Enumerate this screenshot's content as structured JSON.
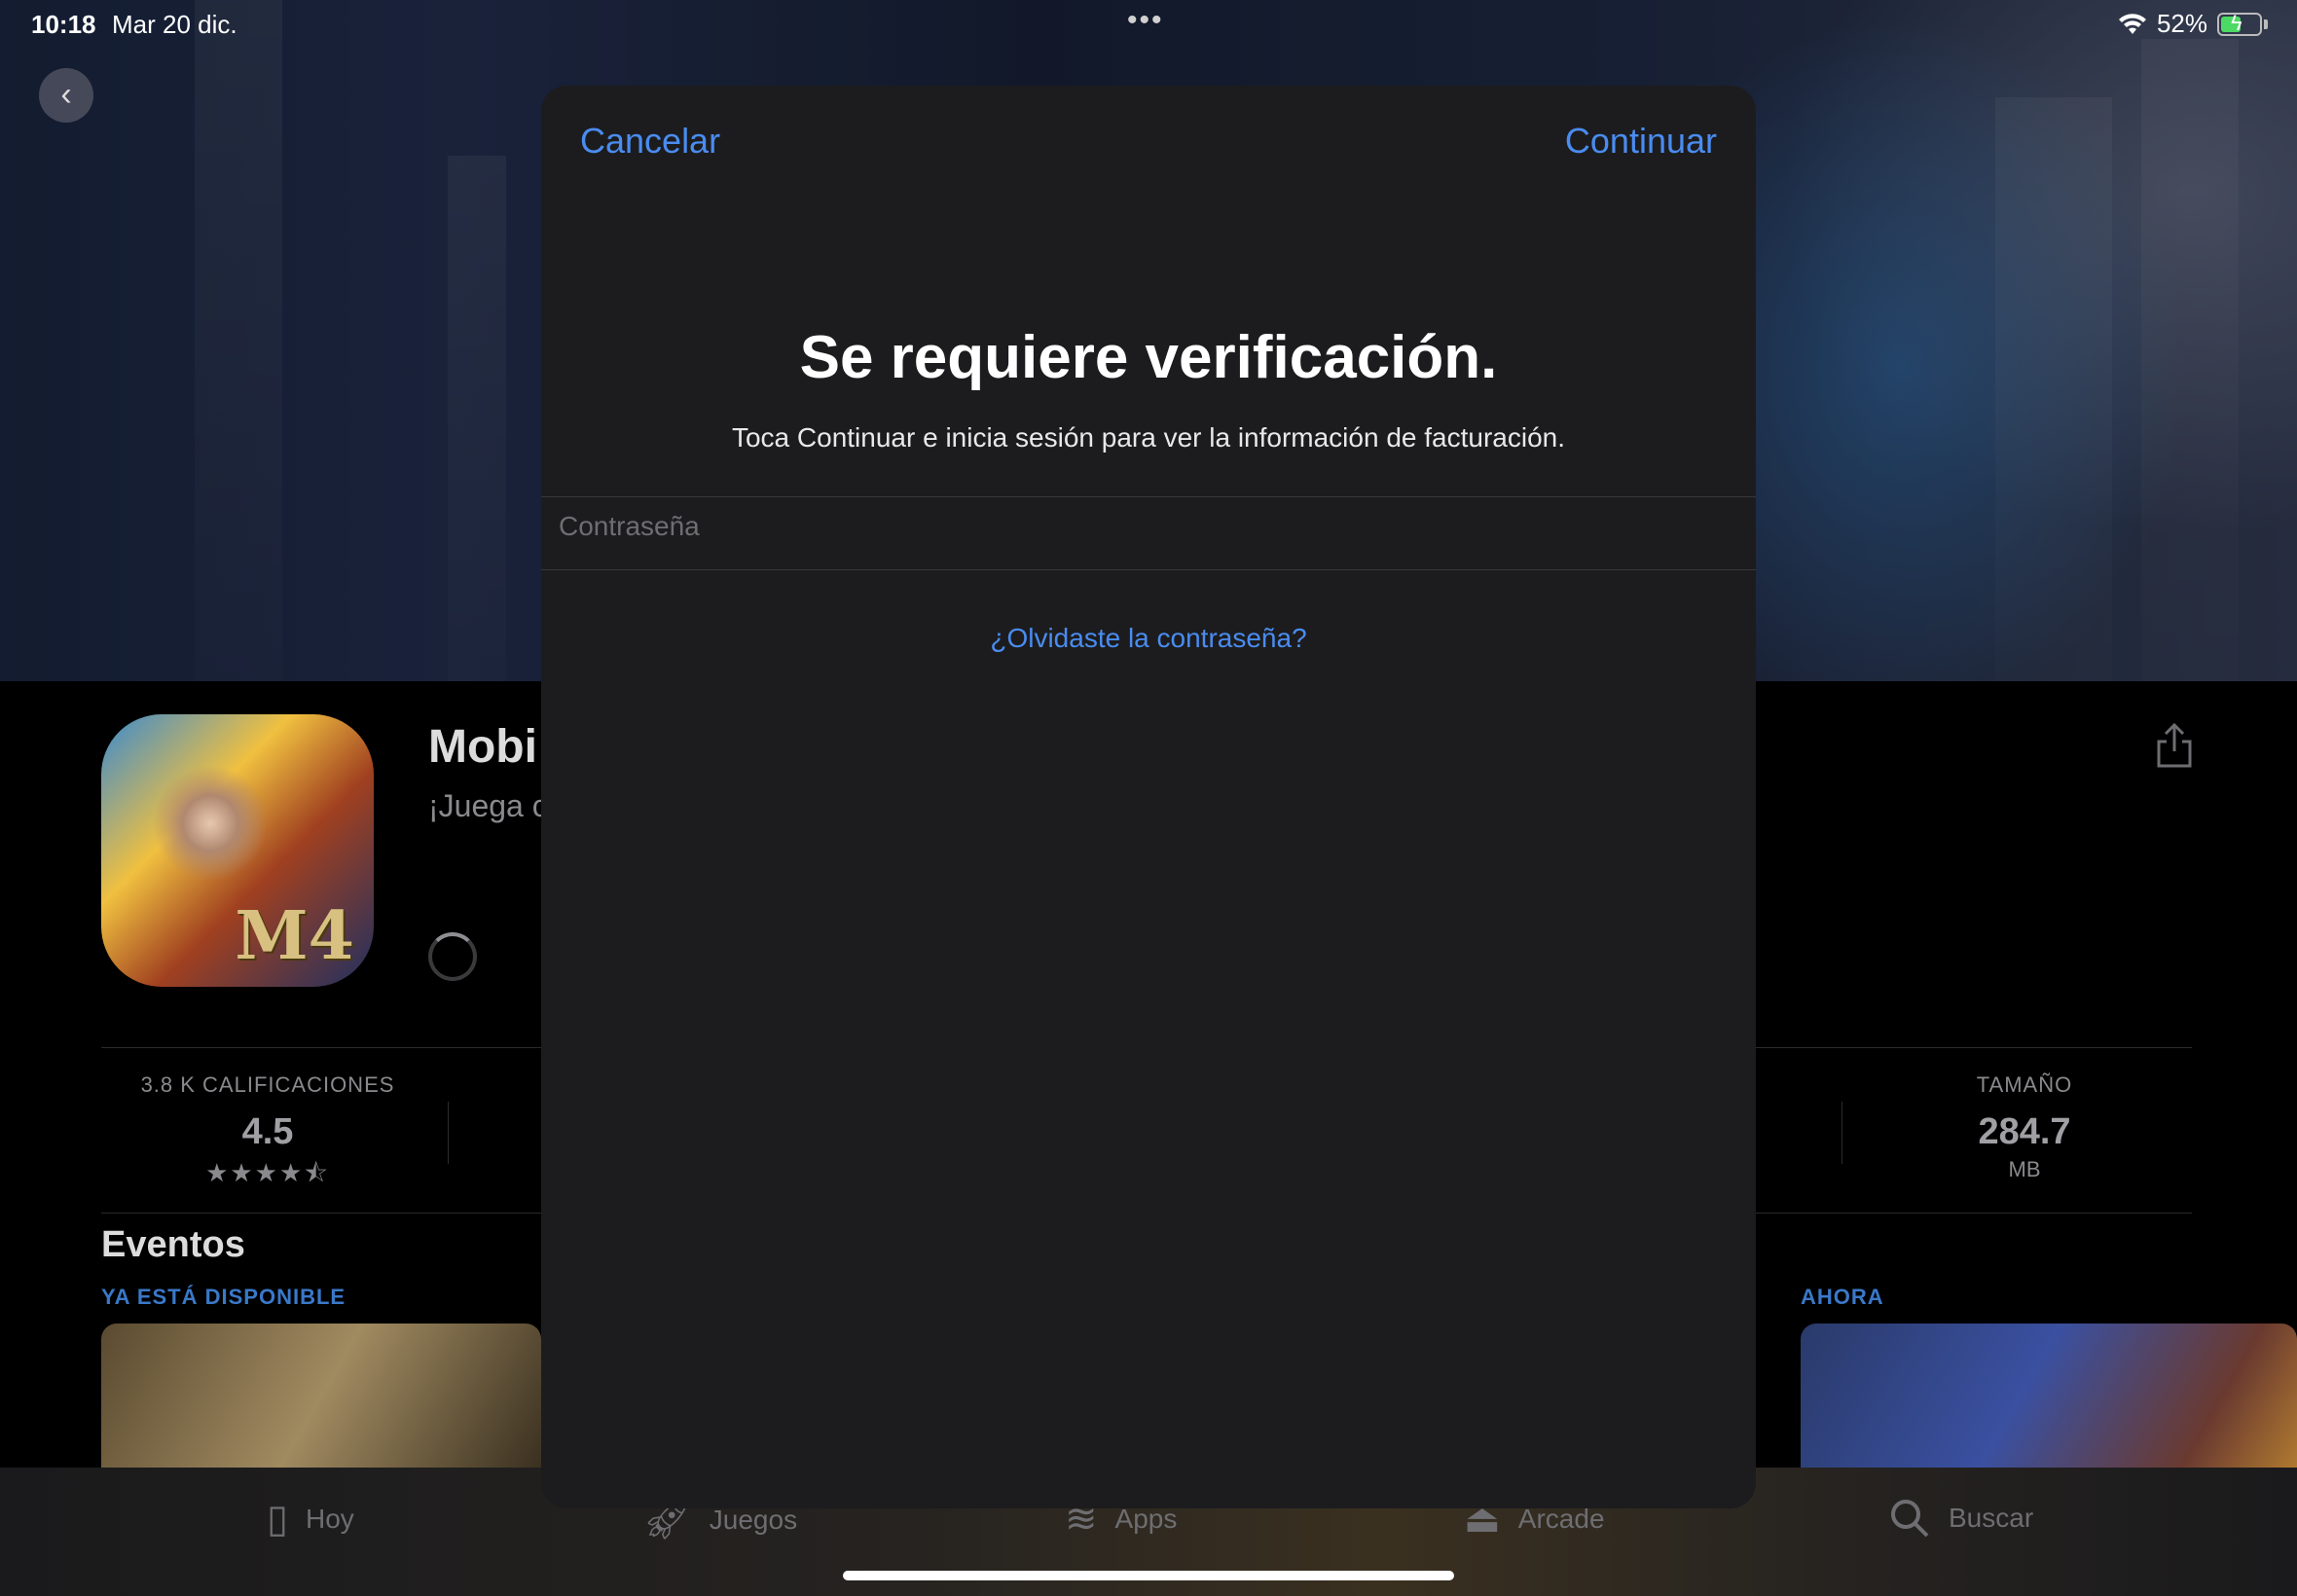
{
  "status_bar": {
    "time": "10:18",
    "date": "Mar 20 dic.",
    "dots": "•••",
    "battery_percent": "52%",
    "battery_level": 0.52,
    "wifi_icon": "wifi-icon"
  },
  "app": {
    "name": "Mobi",
    "subtitle": "¡Juega c",
    "icon_label": "M4"
  },
  "stats": {
    "ratings_label": "3.8 K CALIFICACIONES",
    "ratings_value": "4.5",
    "stars": "★★★★⯪",
    "size_label": "TAMAÑO",
    "size_value": "284.7",
    "size_unit": "MB"
  },
  "events": {
    "title": "Eventos",
    "tag_left": "YA ESTÁ DISPONIBLE",
    "tag_right": "AHORA"
  },
  "tabs": [
    {
      "label": "Hoy",
      "icon": "today-icon"
    },
    {
      "label": "Juegos",
      "icon": "games-icon"
    },
    {
      "label": "Apps",
      "icon": "apps-icon"
    },
    {
      "label": "Arcade",
      "icon": "arcade-icon"
    },
    {
      "label": "Buscar",
      "icon": "search-icon"
    }
  ],
  "modal": {
    "cancel_label": "Cancelar",
    "continue_label": "Continuar",
    "title": "Se requiere verificación.",
    "description": "Toca Continuar e inicia sesión para ver la información de facturación.",
    "password_placeholder": "Contraseña",
    "password_value": "",
    "forgot_label": "¿Olvidaste la contraseña?"
  },
  "colors": {
    "accent": "#4a8cf0",
    "modal_bg": "#1c1c1e",
    "battery": "#4cd964"
  }
}
